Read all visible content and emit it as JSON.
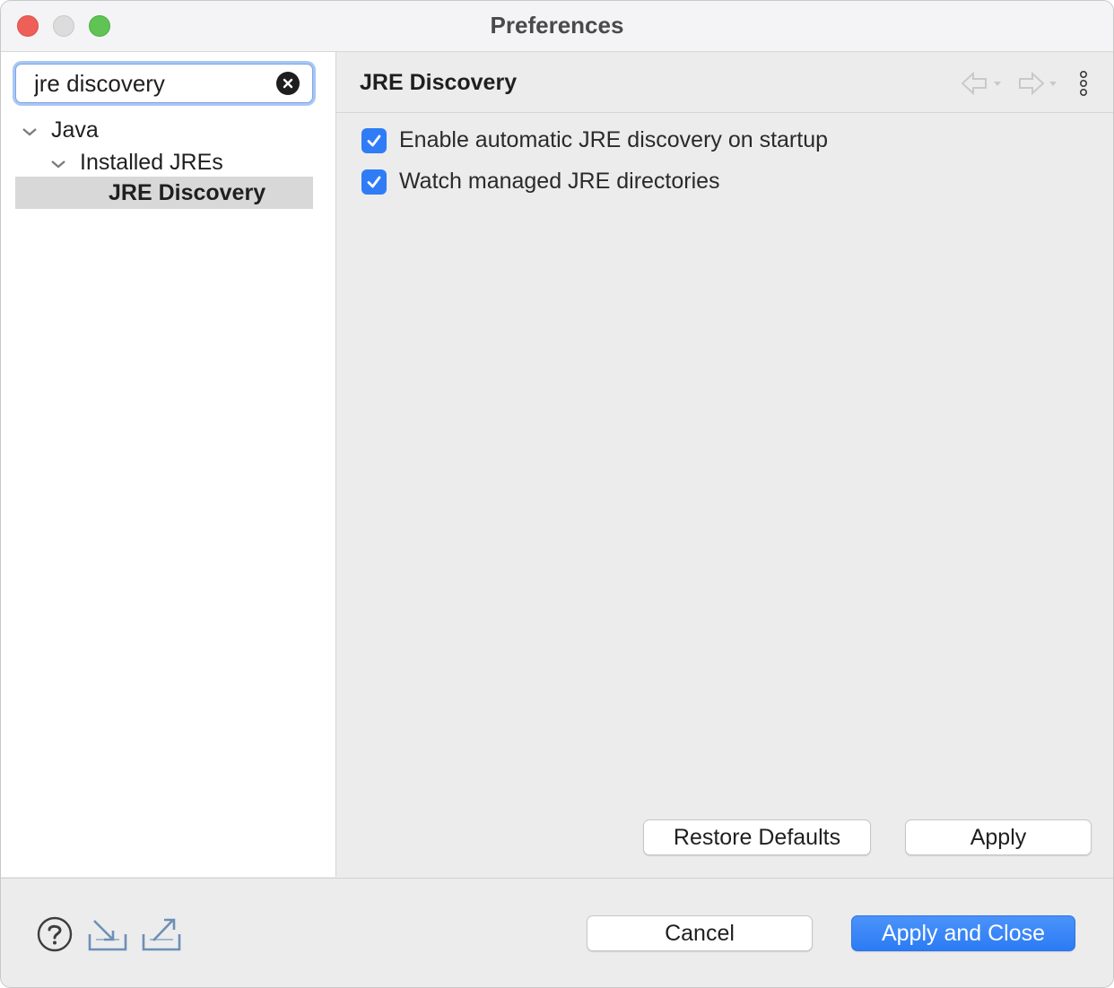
{
  "window": {
    "title": "Preferences"
  },
  "search": {
    "value": "jre discovery",
    "clear_icon": "clear-circle-x"
  },
  "tree": {
    "items": [
      {
        "label": "Java",
        "expanded": true,
        "level": 0
      },
      {
        "label": "Installed JREs",
        "expanded": true,
        "level": 1
      },
      {
        "label": "JRE Discovery",
        "selected": true,
        "level": 2
      }
    ]
  },
  "page": {
    "title": "JRE Discovery",
    "nav_back_icon": "back-arrow-icon",
    "nav_forward_icon": "forward-arrow-icon",
    "menu_icon": "vertical-dots-icon",
    "options": [
      {
        "label": "Enable automatic JRE discovery on startup",
        "checked": true
      },
      {
        "label": "Watch managed JRE directories",
        "checked": true
      }
    ],
    "restore_defaults_label": "Restore Defaults",
    "apply_label": "Apply"
  },
  "footer": {
    "cancel_label": "Cancel",
    "apply_close_label": "Apply and Close"
  },
  "colors": {
    "accent": "#2f7cf6",
    "selection": "#d8d8d8"
  }
}
